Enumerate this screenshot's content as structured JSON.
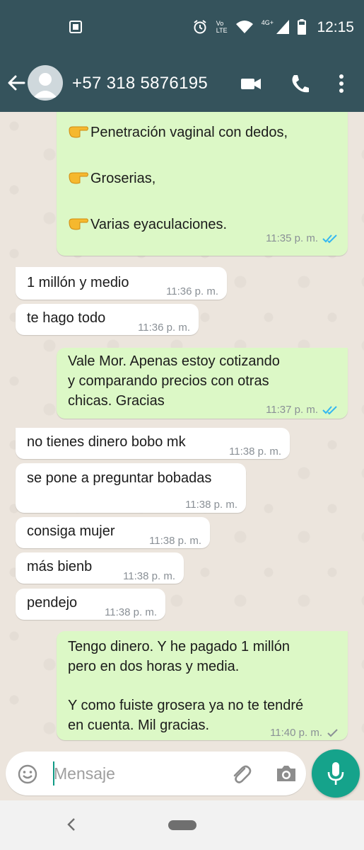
{
  "status_bar": {
    "time": "12:15",
    "network": "4G+",
    "volte": "Vo LTE"
  },
  "header": {
    "contact": "+57 318 5876195"
  },
  "messages": [
    {
      "dir": "out",
      "lines": [
        "Penetración vaginal con dedos,",
        "",
        "Groserias,",
        "",
        "Varias eyaculaciones."
      ],
      "time": "11:35 p. m.",
      "status": "read"
    },
    {
      "dir": "in",
      "lines": [
        "1 millón y medio"
      ],
      "time": "11:36 p. m."
    },
    {
      "dir": "in",
      "lines": [
        "te hago todo"
      ],
      "time": "11:36 p. m."
    },
    {
      "dir": "out",
      "lines": [
        "Vale Mor. Apenas estoy cotizando",
        "y comparando precios con otras",
        "chicas. Gracias"
      ],
      "time": "11:37 p. m.",
      "status": "read"
    },
    {
      "dir": "in",
      "lines": [
        "no tienes dinero bobo mk"
      ],
      "time": "11:38 p. m."
    },
    {
      "dir": "in",
      "lines": [
        "se pone a preguntar bobadas"
      ],
      "time": "11:38 p. m."
    },
    {
      "dir": "in",
      "lines": [
        "consiga mujer"
      ],
      "time": "11:38 p. m."
    },
    {
      "dir": "in",
      "lines": [
        "más bienb"
      ],
      "time": "11:38 p. m."
    },
    {
      "dir": "in",
      "lines": [
        "pendejo"
      ],
      "time": "11:38 p. m."
    },
    {
      "dir": "out",
      "lines": [
        "Tengo dinero. Y he pagado 1 millón",
        "pero en dos horas y media.",
        "",
        "Y como fuiste grosera ya no te tendré",
        "en cuenta. Mil gracias."
      ],
      "time": "11:40 p. m.",
      "status": "sent"
    }
  ],
  "input": {
    "placeholder": "Mensaje"
  },
  "colors": {
    "header": "#35535c",
    "outgoing": "#dcf8c6",
    "incoming": "#ffffff",
    "accent": "#15a38b",
    "read_ticks": "#34b7f1"
  },
  "icons": [
    "back-arrow-icon",
    "video-call-icon",
    "phone-icon",
    "more-vert-icon",
    "emoji-icon",
    "attach-icon",
    "camera-icon",
    "mic-icon",
    "pointing-hand-emoji"
  ]
}
